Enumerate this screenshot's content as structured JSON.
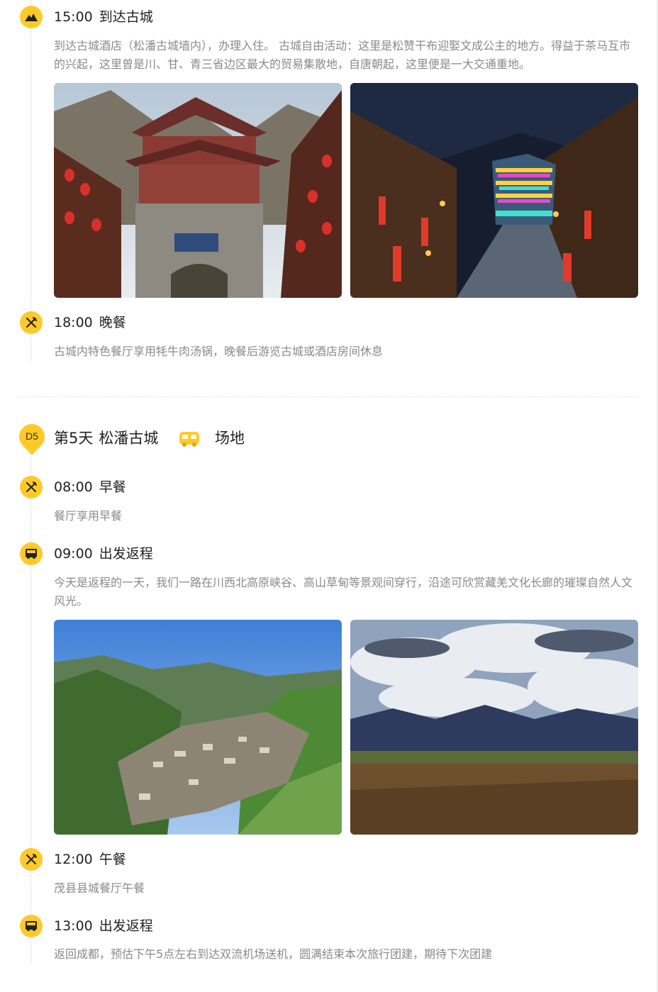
{
  "colors": {
    "accent": "#ffc928",
    "title": "#222222",
    "desc": "#8a8a8a",
    "timeline": "#e6e6e6"
  },
  "day4": {
    "items": [
      {
        "icon": "mountain-icon",
        "time": "15:00",
        "title": "到达古城",
        "desc": "到达古城酒店（松潘古城墙内），办理入住。 古城自由活动：这里是松赞干布迎娶文成公主的地方。得益于茶马互市的兴起，这里曾是川、甘、青三省边区最大的贸易集散地，自唐朝起，这里便是一大交通重地。",
        "photos": [
          {
            "subject": "songpan-ancient-city-gate"
          },
          {
            "subject": "songpan-ancient-city-night-street"
          }
        ]
      },
      {
        "icon": "dining-icon",
        "time": "18:00",
        "title": "晚餐",
        "desc": "古城内特色餐厅享用牦牛肉汤锅，晚餐后游览古城或酒店房间休息"
      }
    ]
  },
  "day5": {
    "badge": "D5",
    "title": "第5天",
    "place": "松潘古城",
    "transport_icon": "bus-icon",
    "venue": "场地",
    "items": [
      {
        "icon": "dining-icon",
        "time": "08:00",
        "title": "早餐",
        "desc": "餐厅享用早餐"
      },
      {
        "icon": "bus-icon",
        "time": "09:00",
        "title": "出发返程",
        "desc": "今天是返程的一天，我们一路在川西北高原峡谷、高山草甸等景观间穿行，沿途可欣赏藏羌文化长廊的璀璨自然人文风光。",
        "photos": [
          {
            "subject": "valley-town-green-mountains"
          },
          {
            "subject": "highland-grassland-cloudy-sky"
          }
        ]
      },
      {
        "icon": "dining-icon",
        "time": "12:00",
        "title": "午餐",
        "desc": "茂县县城餐厅午餐"
      },
      {
        "icon": "bus-icon",
        "time": "13:00",
        "title": "出发返程",
        "desc": "返回成都，预估下午5点左右到达双流机场送机，圆满结束本次旅行团建，期待下次团建"
      }
    ]
  }
}
